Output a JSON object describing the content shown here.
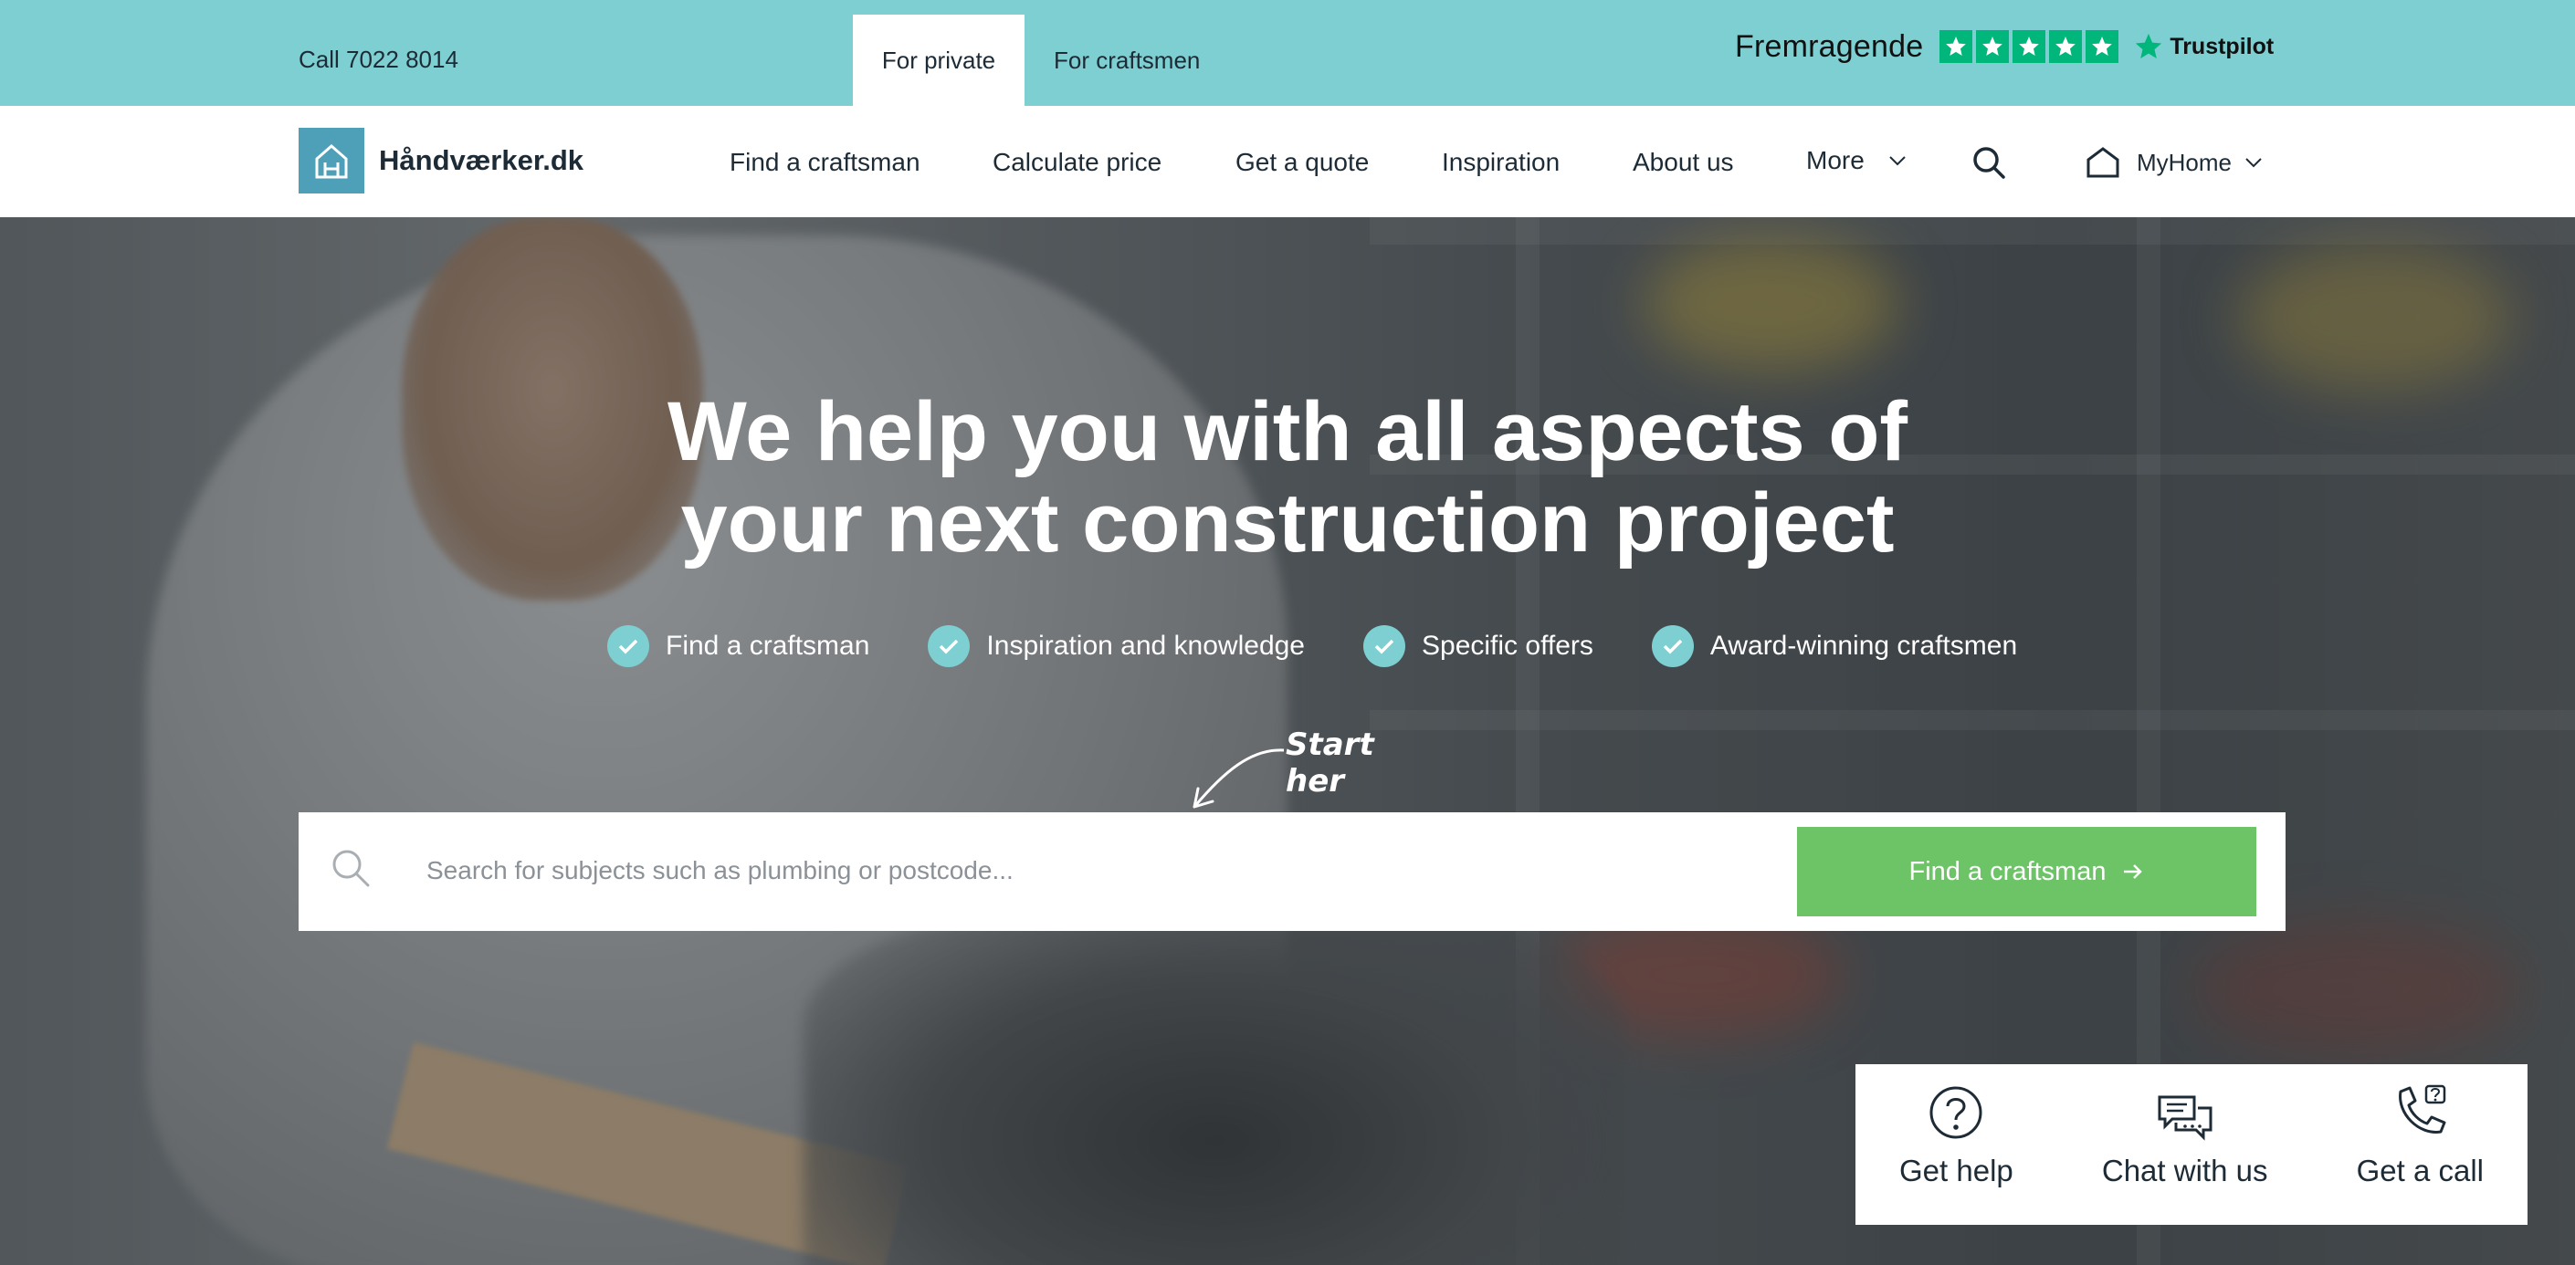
{
  "topbar": {
    "phone": "Call 7022 8014",
    "tabs": [
      {
        "label": "For private",
        "active": true
      },
      {
        "label": "For craftsmen",
        "active": false
      }
    ],
    "trustpilot": {
      "rating_word": "Fremragende",
      "stars": 5,
      "brand": "Trustpilot",
      "star_color": "#00b67a"
    }
  },
  "nav": {
    "logo_text": "Håndværker.dk",
    "items": [
      "Find a craftsman",
      "Calculate price",
      "Get a quote",
      "Inspiration",
      "About us"
    ],
    "more_label": "More",
    "myhome_label": "MyHome",
    "icons": [
      "chevron-down-icon",
      "search-icon",
      "house-icon"
    ]
  },
  "hero": {
    "title_line1": "We help you with all aspects of",
    "title_line2": "your next construction project",
    "benefits": [
      "Find a craftsman",
      "Inspiration and knowledge",
      "Specific offers",
      "Award-winning craftsmen"
    ],
    "hint": "Start her",
    "search": {
      "placeholder": "Search for subjects such as plumbing or postcode...",
      "button_label": "Find a craftsman"
    }
  },
  "help": {
    "items": [
      {
        "label": "Get help",
        "icon": "question-icon"
      },
      {
        "label": "Chat with us",
        "icon": "chat-icon"
      },
      {
        "label": "Get a call",
        "icon": "phone-icon"
      }
    ]
  },
  "colors": {
    "topbar_bg": "#7dcfd1",
    "accent_green": "#6cc466",
    "logo_blue": "#4e9fb8",
    "text_dark": "#1d2b36"
  }
}
